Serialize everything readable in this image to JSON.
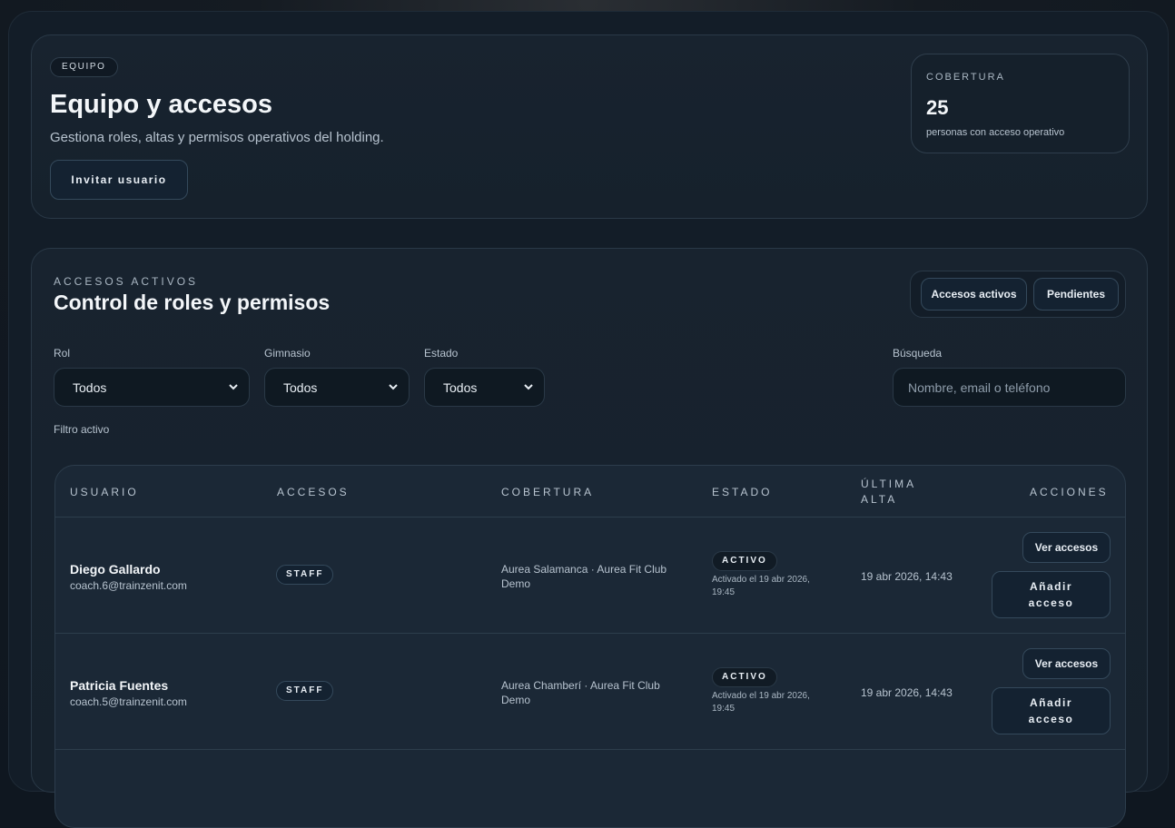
{
  "hero": {
    "tag": "EQUIPO",
    "title": "Equipo y accesos",
    "subtitle": "Gestiona roles, altas y permisos operativos del holding.",
    "invite_label": "Invitar usuario",
    "coverage": {
      "label": "COBERTURA",
      "count": "25",
      "description": "personas con acceso operativo"
    }
  },
  "main": {
    "eyebrow": "ACCESOS ACTIVOS",
    "title": "Control de roles y permisos",
    "segments": [
      "Accesos activos",
      "Pendientes"
    ],
    "filters": {
      "rol": {
        "label": "Rol",
        "value": "Todos"
      },
      "gimnasio": {
        "label": "Gimnasio",
        "value": "Todos"
      },
      "estado": {
        "label": "Estado",
        "value": "Todos"
      },
      "busqueda": {
        "label": "Búsqueda",
        "placeholder": "Nombre, email o teléfono"
      }
    },
    "filter_active": "Filtro activo"
  },
  "table": {
    "headers": {
      "usuario": "USUARIO",
      "accesos": "ACCESOS",
      "cobertura": "COBERTURA",
      "estado": "ESTADO",
      "ultima_1": "ÚLTIMA",
      "ultima_2": "ALTA",
      "acciones": "ACCIONES"
    },
    "rows": [
      {
        "name": "Diego Gallardo",
        "email": "coach.6@trainzenit.com",
        "role": "STAFF",
        "coverage": "Aurea Salamanca · Aurea Fit Club Demo",
        "status": "ACTIVO",
        "activated": "Activado el 19 abr 2026, 19:45",
        "last_alta": "19 abr 2026, 14:43",
        "view_label": "Ver accesos",
        "add_label_1": "Añadir",
        "add_label_2": "acceso"
      },
      {
        "name": "Patricia Fuentes",
        "email": "coach.5@trainzenit.com",
        "role": "STAFF",
        "coverage": "Aurea Chamberí · Aurea Fit Club Demo",
        "status": "ACTIVO",
        "activated": "Activado el 19 abr 2026, 19:45",
        "last_alta": "19 abr 2026, 14:43",
        "view_label": "Ver accesos",
        "add_label_1": "Añadir",
        "add_label_2": "acceso"
      }
    ]
  }
}
